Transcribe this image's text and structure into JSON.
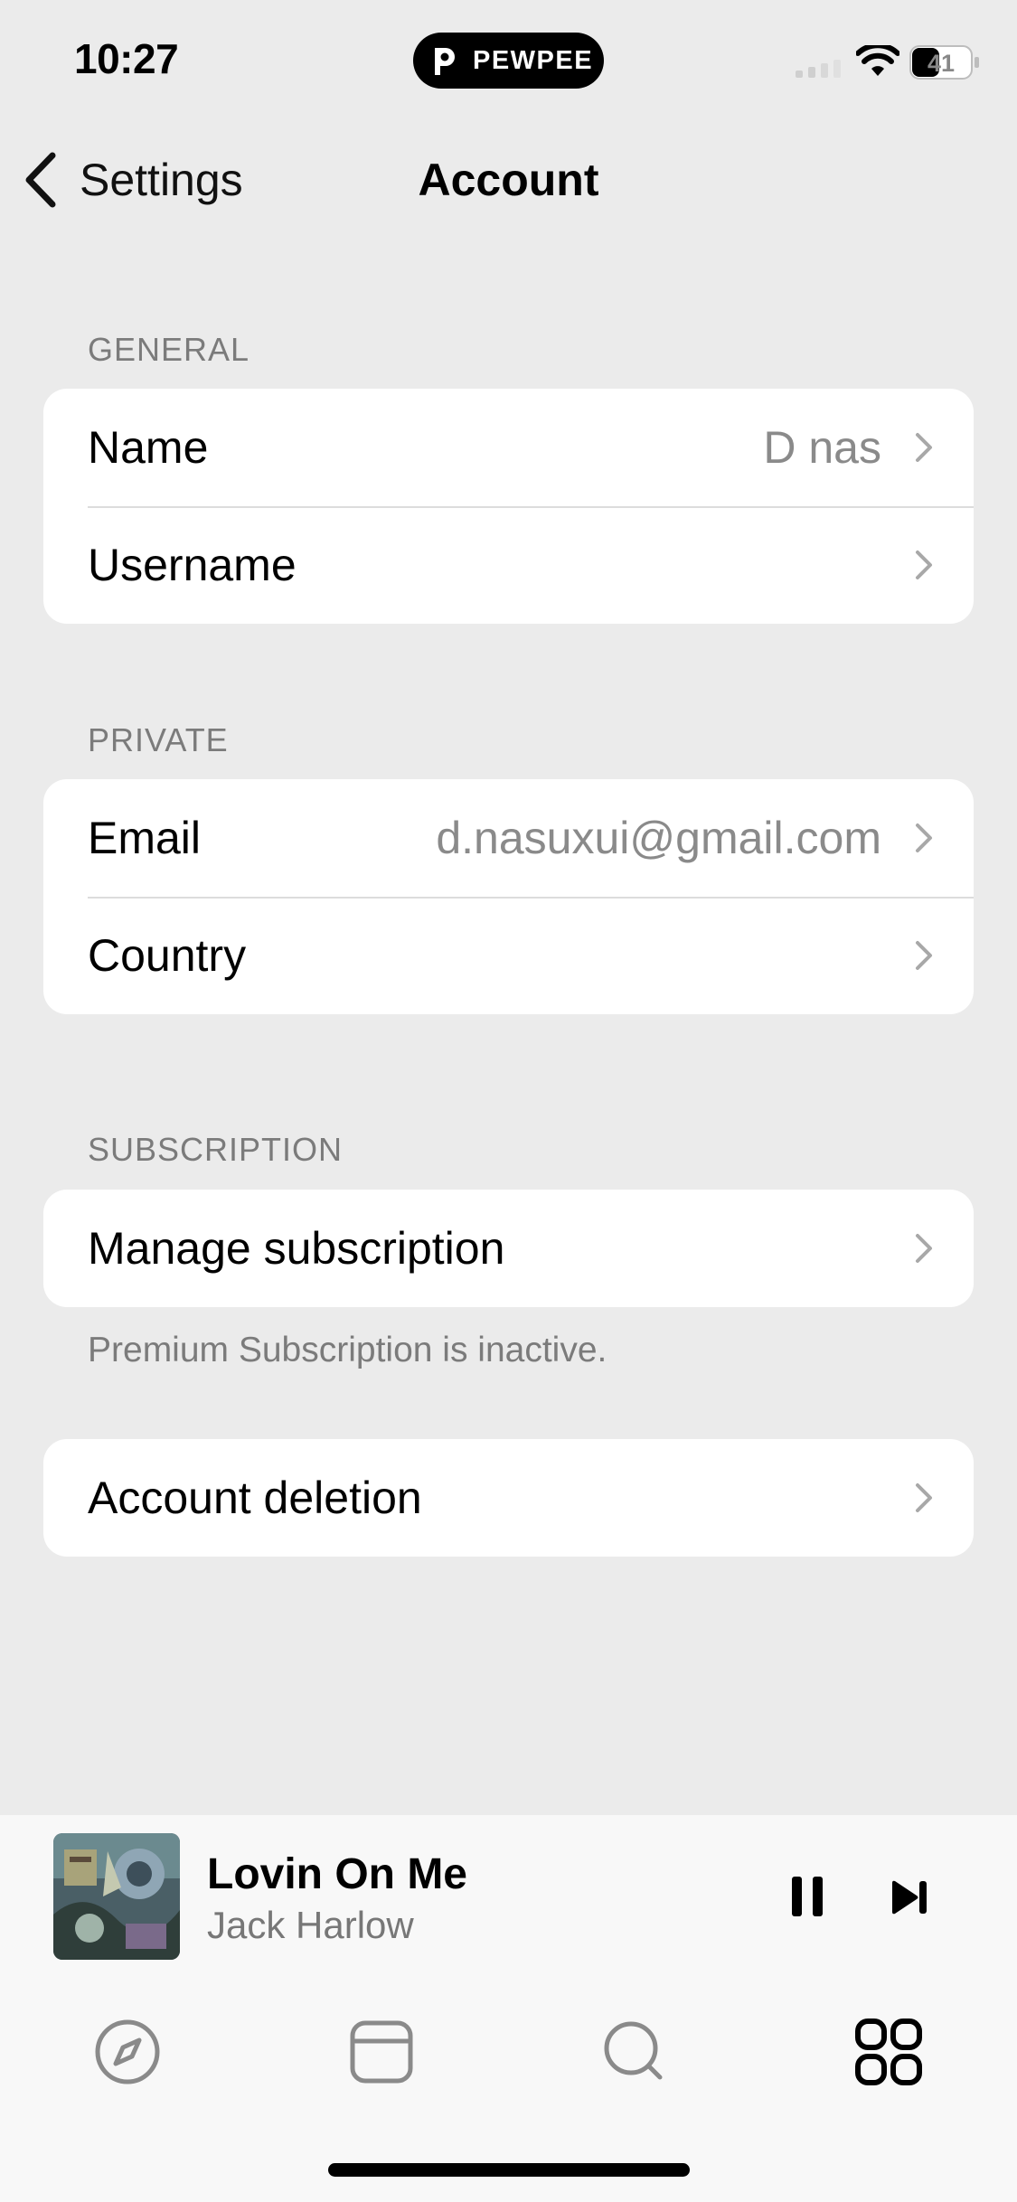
{
  "status_bar": {
    "time": "10:27",
    "app_pill": "PEWPEE",
    "battery": "41"
  },
  "nav": {
    "back_label": "Settings",
    "title": "Account"
  },
  "sections": {
    "general": {
      "header": "GENERAL",
      "rows": [
        {
          "label": "Name",
          "value": "D nas"
        },
        {
          "label": "Username",
          "value": ""
        }
      ]
    },
    "private": {
      "header": "PRIVATE",
      "rows": [
        {
          "label": "Email",
          "value": "d.nasuxui@gmail.com"
        },
        {
          "label": "Country",
          "value": ""
        }
      ]
    },
    "subscription": {
      "header": "SUBSCRIPTION",
      "rows": [
        {
          "label": "Manage subscription"
        }
      ],
      "footnote": "Premium Subscription is inactive."
    },
    "deletion": {
      "rows": [
        {
          "label": "Account deletion"
        }
      ]
    }
  },
  "player": {
    "title": "Lovin On Me",
    "artist": "Jack Harlow"
  },
  "tabs": [
    {
      "icon": "compass-icon"
    },
    {
      "icon": "library-icon"
    },
    {
      "icon": "search-icon"
    },
    {
      "icon": "grid-icon",
      "active": true
    }
  ]
}
